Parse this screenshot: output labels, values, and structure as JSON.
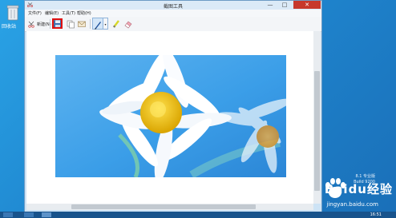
{
  "desktop": {
    "recycle_bin_label": "回收站",
    "watermark_lines": [
      "8.1 专业版",
      "Build 9200"
    ]
  },
  "window": {
    "title": "截图工具",
    "minimize_glyph": "—",
    "maximize_glyph": "□",
    "close_glyph": "✕"
  },
  "menubar": {
    "items": [
      "文件(F)",
      "编辑(E)",
      "工具(T)",
      "帮助(H)"
    ]
  },
  "toolbar": {
    "new_label": "新建(N)",
    "dropdown_glyph": "▾"
  },
  "overlay": {
    "brand": "Baidu经验",
    "url": "jingyan.baidu.com"
  },
  "taskbar": {
    "time": "16:51"
  },
  "colors": {
    "close_red": "#c7382c",
    "highlight_red": "#e01010",
    "photo_sky": "#3b9ee8",
    "flower_center": "#f2c500"
  }
}
